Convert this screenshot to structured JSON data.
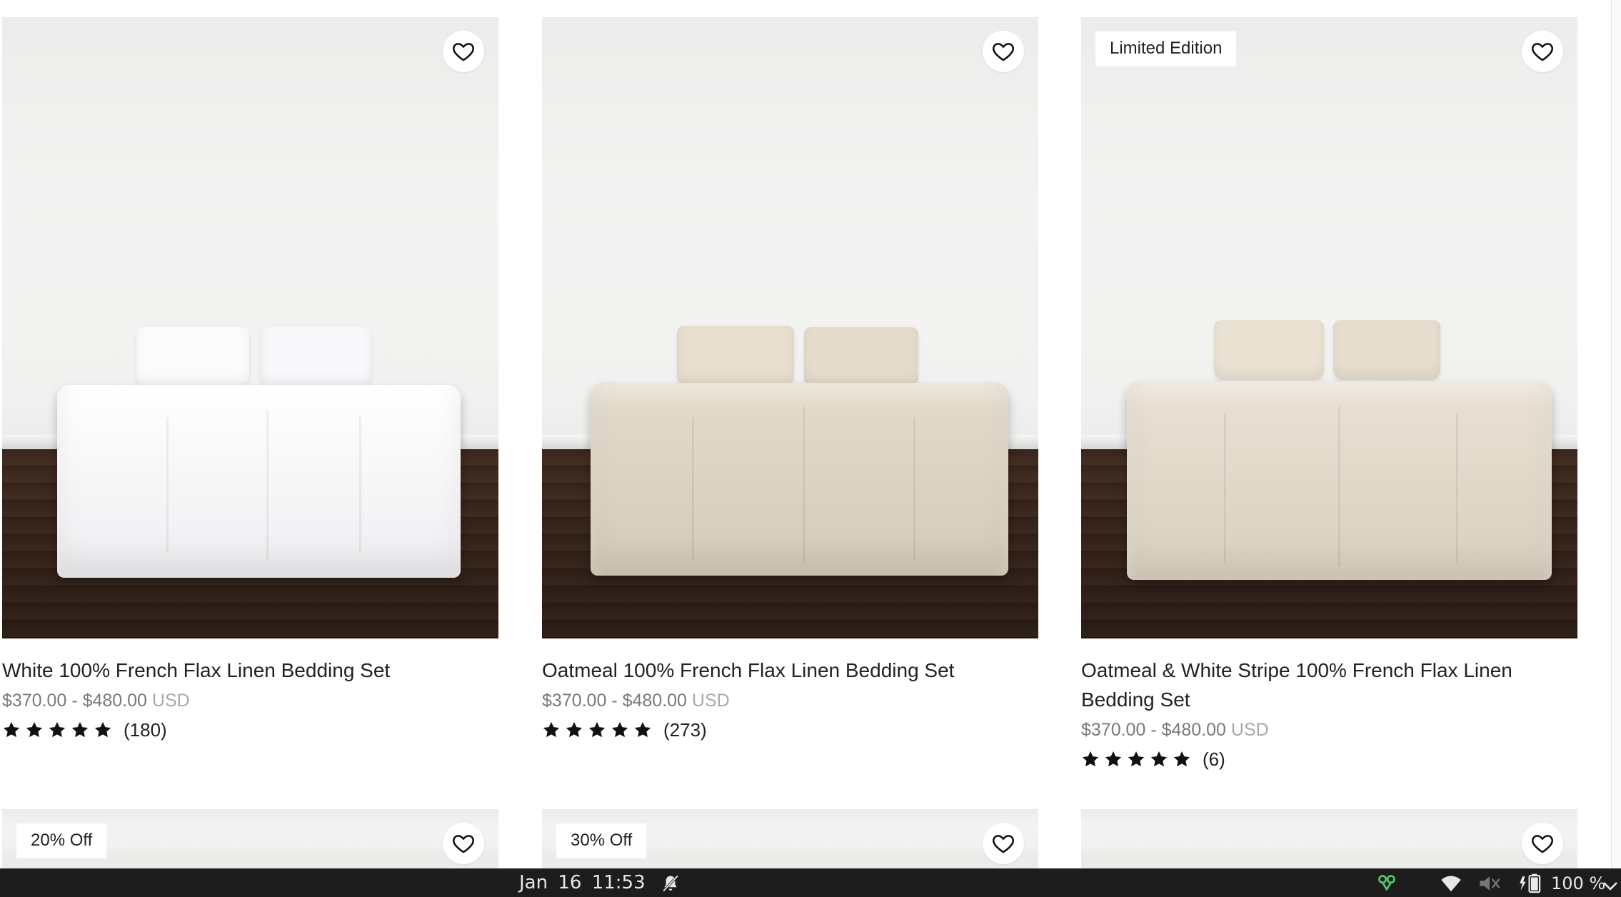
{
  "products": [
    {
      "title": "White 100% French Flax Linen Bedding Set",
      "price_range": "$370.00 - $480.00",
      "currency": "USD",
      "rating_count": "(180)",
      "badge": "",
      "linen_color": "#f7f7f9",
      "pillow_color": "#fbfbfc"
    },
    {
      "title": "Oatmeal 100% French Flax Linen Bedding Set",
      "price_range": "$370.00 - $480.00",
      "currency": "USD",
      "rating_count": "(273)",
      "badge": "",
      "linen_color": "#ddd4c3",
      "pillow_color": "#e6ddcd"
    },
    {
      "title": "Oatmeal & White Stripe 100% French Flax Linen Bedding Set",
      "price_range": "$370.00 - $480.00",
      "currency": "USD",
      "rating_count": "(6)",
      "badge": "Limited Edition",
      "linen_color": "#e2d9c9",
      "pillow_color": "#e8e0d1"
    }
  ],
  "next_row": [
    {
      "badge": "20% Off"
    },
    {
      "badge": "30% Off"
    },
    {
      "badge": ""
    }
  ],
  "rating_stars": 5,
  "icons": {
    "favorite": "heart-icon",
    "rating": "star-icon",
    "notifications": "bell-off-icon",
    "network": "wifi-icon",
    "volume": "speaker-muted-icon",
    "battery": "battery-charging-icon",
    "menu": "chevron-down-icon"
  },
  "taskbar": {
    "date": "Jan 16",
    "time": "11:53",
    "battery_percent": "100 %"
  },
  "colors": {
    "accent_tray": "#57c26d",
    "text": "#222222",
    "price": "#7a7a7a",
    "currency": "#a9a9a9"
  }
}
